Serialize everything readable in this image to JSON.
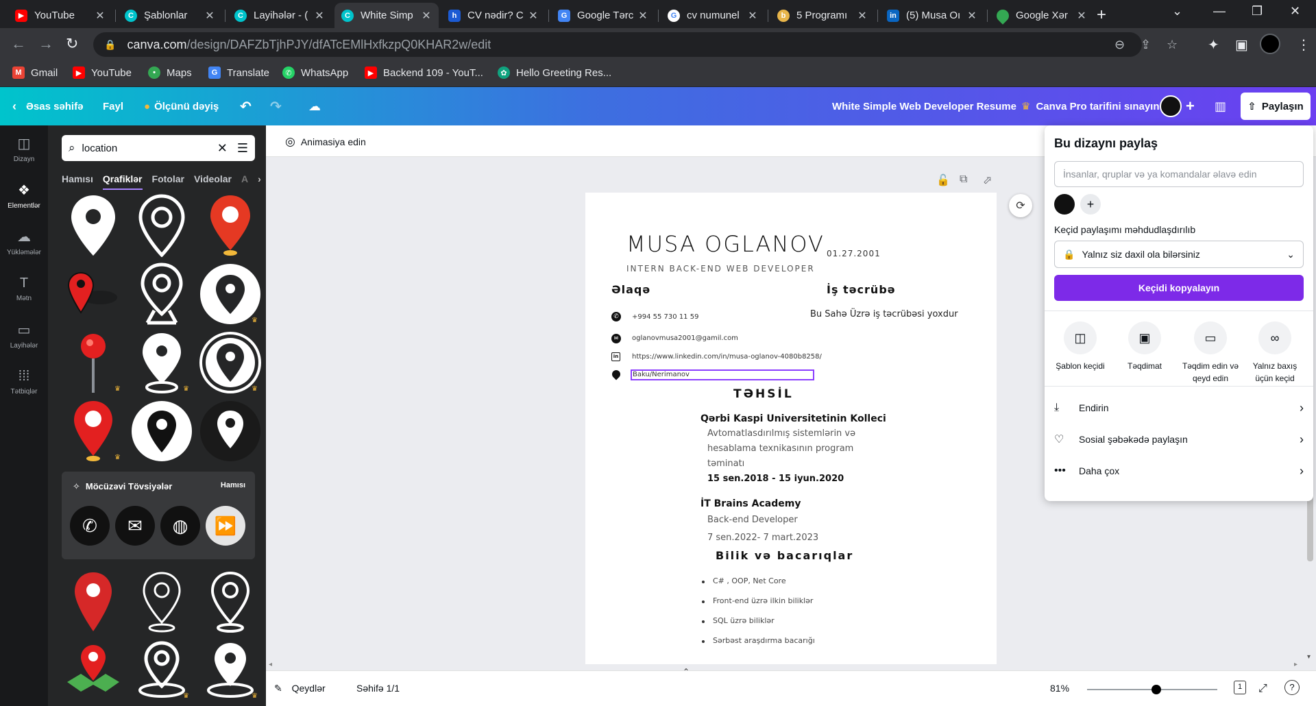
{
  "browser": {
    "tabs": [
      {
        "title": "YouTube",
        "favicon": "youtube-icon",
        "color": "#ff0000"
      },
      {
        "title": "Şablonlar",
        "favicon": "canva-icon",
        "color": "#00c4cc"
      },
      {
        "title": "Layihələr - (",
        "favicon": "canva-icon",
        "color": "#00c4cc"
      },
      {
        "title": "White Simp",
        "favicon": "canva-icon",
        "color": "#00c4cc"
      },
      {
        "title": "CV nədir? C",
        "favicon": "h-icon",
        "color": "#1c5bd4"
      },
      {
        "title": "Google Tərc",
        "favicon": "translate-icon",
        "color": "#4285f4"
      },
      {
        "title": "cv numunel",
        "favicon": "google-icon",
        "color": "#ffffff"
      },
      {
        "title": "5 Programı",
        "favicon": "site-icon",
        "color": "#e8b54a"
      },
      {
        "title": "(5) Musa Oı",
        "favicon": "linkedin-icon",
        "color": "#0a66c2"
      },
      {
        "title": "Google Xər",
        "favicon": "maps-icon",
        "color": "#34a853"
      }
    ],
    "url_host": "canva.com",
    "url_path": "/design/DAFZbTjhPJY/dfATcEMlHxfkzpQ0KHAR2w/edit",
    "bookmarks": [
      {
        "label": "Gmail",
        "icon": "gmail-icon",
        "color": "#ea4335"
      },
      {
        "label": "YouTube",
        "icon": "youtube-icon",
        "color": "#ff0000"
      },
      {
        "label": "Maps",
        "icon": "maps-icon",
        "color": "#34a853"
      },
      {
        "label": "Translate",
        "icon": "translate-icon",
        "color": "#4285f4"
      },
      {
        "label": "WhatsApp",
        "icon": "whatsapp-icon",
        "color": "#25d366"
      },
      {
        "label": "Backend 109 - YouT...",
        "icon": "youtube-icon",
        "color": "#ff0000"
      },
      {
        "label": "Hello Greeting Res...",
        "icon": "chatgpt-icon",
        "color": "#10a37f"
      }
    ]
  },
  "canva": {
    "home": "Əsas səhifə",
    "file": "Fayl",
    "resize": "Ölçünü dəyiş",
    "design_title": "White Simple Web Developer Resume",
    "pro_trial": "Canva Pro tarifini sınayın",
    "share_btn": "Paylaşın",
    "animate": "Animasiya edin",
    "notes": "Qeydlər",
    "page_count": "Səhifə 1/1",
    "zoom": "81%",
    "page_number": "1"
  },
  "rail": [
    {
      "label": "Dizayn",
      "icon": "design-icon"
    },
    {
      "label": "Elementlər",
      "icon": "elements-icon"
    },
    {
      "label": "Yükləmələr",
      "icon": "upload-icon"
    },
    {
      "label": "Mətn",
      "icon": "text-icon"
    },
    {
      "label": "Layihələr",
      "icon": "folder-icon"
    },
    {
      "label": "Tətbiqlər",
      "icon": "apps-icon"
    }
  ],
  "panel": {
    "search_value": "location",
    "tabs": [
      "Hamısı",
      "Qrafiklər",
      "Fotolar",
      "Videolar",
      "A"
    ],
    "magic_title": "Möcüzəvi Tövsiyələr",
    "magic_all": "Hamısı"
  },
  "resume": {
    "name": "MUSA OGLANOV",
    "dob": "01.27.2001",
    "role": "INTERN BACK-END WEB DEVELOPER",
    "contact_heading": "Əlaqə",
    "exp_heading": "İş təcrübə",
    "exp_text": "Bu Sahə Üzrə iş təcrübəsi yoxdur",
    "phone": "+994 55 730 11 59",
    "email": "oglanovmusa2001@gamil.com",
    "linkedin": "https://www.linkedin.com/in/musa-oglanov-4080b8258/",
    "location": "Baku/Nerimanov",
    "edu_heading": "TƏHSİL",
    "school1": "Qərbi Kaspi Universitetinin Kolleci",
    "school1_desc_1": "Avtomatlasdırılmış sistemlərin və",
    "school1_desc_2": "hesablama texnikasının program",
    "school1_desc_3": "təminatı",
    "school1_dates": "15 sen.2018 - 15 iyun.2020",
    "school2": "İT Brains Academy",
    "school2_desc": "Back-end Developer",
    "school2_dates": "7 sen.2022- 7 mart.2023",
    "skills_heading": "Bilik və bacarıqlar",
    "skills": [
      "C# , OOP, Net Core",
      "Front-end üzrə ilkin biliklər",
      "SQL üzrə biliklər",
      "Sərbəst araşdırma bacarığı"
    ]
  },
  "share": {
    "title": "Bu dizaynı paylaş",
    "input_placeholder": "İnsanlar, qruplar və ya komandalar əlavə edin",
    "link_label": "Keçid paylaşımı məhdudlaşdırılıb",
    "link_value": "Yalnız siz daxil ola bilərsiniz",
    "copy_btn": "Keçidi kopyalayın",
    "options": [
      {
        "label": "Şablon keçidi",
        "icon": "template-icon"
      },
      {
        "label": "Təqdimat",
        "icon": "present-icon"
      },
      {
        "label": "Təqdim edin və qeyd edin",
        "icon": "record-icon"
      },
      {
        "label": "Yalnız baxış üçün keçid",
        "icon": "link-icon"
      }
    ],
    "download": "Endirin",
    "social": "Sosial şəbəkədə paylaşın",
    "more": "Daha çox"
  }
}
